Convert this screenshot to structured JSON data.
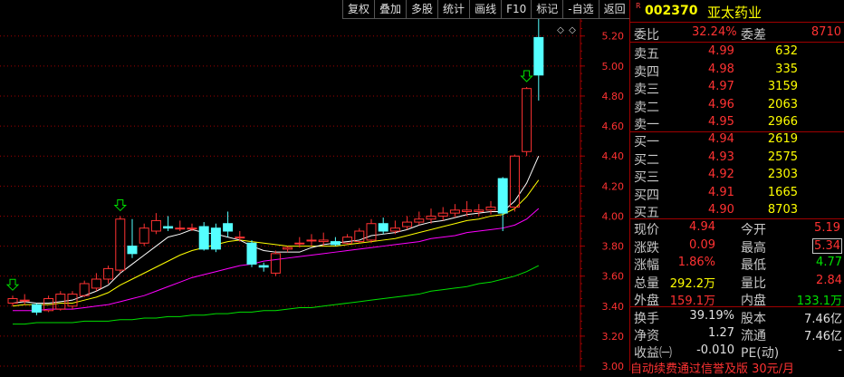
{
  "toolbar": {
    "items": [
      "复权",
      "叠加",
      "多股",
      "统计",
      "画线",
      "F10",
      "标记",
      "-自选",
      "返回"
    ]
  },
  "chart": {
    "y_axis_labels": [
      "5.20",
      "5.00",
      "4.80",
      "4.60",
      "4.40",
      "4.20",
      "4.00",
      "3.80",
      "3.60",
      "3.40",
      "3.20",
      "3.00"
    ],
    "max_marker": "5.34",
    "diamond": "◇"
  },
  "chart_data": {
    "type": "candlestick",
    "y_axis_ticks": [
      5.2,
      5.0,
      4.8,
      4.6,
      4.4,
      4.2,
      4.0,
      3.8,
      3.6,
      3.4,
      3.2,
      3.0
    ],
    "ylim": [
      2.97,
      5.44
    ],
    "candles": [
      {
        "o": 3.42,
        "c": 3.45,
        "h": 3.47,
        "l": 3.4
      },
      {
        "o": 3.44,
        "c": 3.44,
        "h": 3.48,
        "l": 3.41
      },
      {
        "o": 3.41,
        "c": 3.36,
        "h": 3.42,
        "l": 3.34
      },
      {
        "o": 3.37,
        "c": 3.45,
        "h": 3.47,
        "l": 3.36
      },
      {
        "o": 3.38,
        "c": 3.48,
        "h": 3.5,
        "l": 3.37
      },
      {
        "o": 3.4,
        "c": 3.48,
        "h": 3.5,
        "l": 3.38
      },
      {
        "o": 3.47,
        "c": 3.55,
        "h": 3.57,
        "l": 3.46
      },
      {
        "o": 3.52,
        "c": 3.58,
        "h": 3.62,
        "l": 3.5
      },
      {
        "o": 3.58,
        "c": 3.65,
        "h": 3.67,
        "l": 3.55
      },
      {
        "o": 3.64,
        "c": 3.98,
        "h": 4.0,
        "l": 3.62
      },
      {
        "o": 3.8,
        "c": 3.75,
        "h": 3.98,
        "l": 3.72
      },
      {
        "o": 3.82,
        "c": 3.92,
        "h": 3.95,
        "l": 3.8
      },
      {
        "o": 3.9,
        "c": 3.97,
        "h": 4.02,
        "l": 3.88
      },
      {
        "o": 3.93,
        "c": 3.92,
        "h": 4.0,
        "l": 3.9
      },
      {
        "o": 3.92,
        "c": 3.92,
        "h": 3.97,
        "l": 3.9
      },
      {
        "o": 3.92,
        "c": 3.92,
        "h": 3.95,
        "l": 3.9
      },
      {
        "o": 3.93,
        "c": 3.78,
        "h": 3.96,
        "l": 3.77
      },
      {
        "o": 3.92,
        "c": 3.78,
        "h": 3.95,
        "l": 3.76
      },
      {
        "o": 3.95,
        "c": 3.9,
        "h": 4.03,
        "l": 3.86
      },
      {
        "o": 3.86,
        "c": 3.86,
        "h": 3.9,
        "l": 3.83
      },
      {
        "o": 3.82,
        "c": 3.68,
        "h": 3.84,
        "l": 3.66
      },
      {
        "o": 3.67,
        "c": 3.66,
        "h": 3.69,
        "l": 3.63
      },
      {
        "o": 3.62,
        "c": 3.75,
        "h": 3.77,
        "l": 3.6
      },
      {
        "o": 3.78,
        "c": 3.79,
        "h": 3.8,
        "l": 3.76
      },
      {
        "o": 3.82,
        "c": 3.82,
        "h": 3.86,
        "l": 3.79
      },
      {
        "o": 3.84,
        "c": 3.84,
        "h": 3.88,
        "l": 3.8
      },
      {
        "o": 3.83,
        "c": 3.84,
        "h": 3.89,
        "l": 3.8
      },
      {
        "o": 3.83,
        "c": 3.81,
        "h": 3.86,
        "l": 3.8
      },
      {
        "o": 3.82,
        "c": 3.86,
        "h": 3.88,
        "l": 3.81
      },
      {
        "o": 3.83,
        "c": 3.9,
        "h": 3.92,
        "l": 3.82
      },
      {
        "o": 3.84,
        "c": 3.95,
        "h": 3.98,
        "l": 3.82
      },
      {
        "o": 3.95,
        "c": 3.9,
        "h": 3.99,
        "l": 3.88
      },
      {
        "o": 3.9,
        "c": 3.92,
        "h": 3.97,
        "l": 3.88
      },
      {
        "o": 3.93,
        "c": 3.96,
        "h": 4.0,
        "l": 3.91
      },
      {
        "o": 3.96,
        "c": 3.98,
        "h": 4.03,
        "l": 3.94
      },
      {
        "o": 3.98,
        "c": 4.0,
        "h": 4.05,
        "l": 3.95
      },
      {
        "o": 4.0,
        "c": 4.02,
        "h": 4.06,
        "l": 3.97
      },
      {
        "o": 4.02,
        "c": 4.04,
        "h": 4.08,
        "l": 3.99
      },
      {
        "o": 4.03,
        "c": 4.04,
        "h": 4.1,
        "l": 4.0
      },
      {
        "o": 4.03,
        "c": 4.04,
        "h": 4.08,
        "l": 4.0
      },
      {
        "o": 4.04,
        "c": 4.06,
        "h": 4.1,
        "l": 4.01
      },
      {
        "o": 4.25,
        "c": 4.02,
        "h": 4.26,
        "l": 3.9
      },
      {
        "o": 4.06,
        "c": 4.4,
        "h": 4.41,
        "l": 4.03
      },
      {
        "o": 4.43,
        "c": 4.85,
        "h": 4.86,
        "l": 4.4
      },
      {
        "o": 5.19,
        "c": 4.94,
        "h": 5.34,
        "l": 4.77
      }
    ],
    "ma_short": [
      3.42,
      3.43,
      3.42,
      3.42,
      3.43,
      3.44,
      3.47,
      3.5,
      3.54,
      3.62,
      3.68,
      3.74,
      3.8,
      3.86,
      3.88,
      3.91,
      3.89,
      3.88,
      3.86,
      3.84,
      3.8,
      3.77,
      3.76,
      3.76,
      3.76,
      3.79,
      3.81,
      3.82,
      3.83,
      3.84,
      3.87,
      3.88,
      3.89,
      3.91,
      3.94,
      3.96,
      3.97,
      3.99,
      4.01,
      4.02,
      4.03,
      4.03,
      4.1,
      4.22,
      4.4
    ],
    "ma_mid": [
      3.4,
      3.41,
      3.41,
      3.41,
      3.42,
      3.42,
      3.44,
      3.46,
      3.49,
      3.54,
      3.58,
      3.62,
      3.66,
      3.7,
      3.74,
      3.77,
      3.79,
      3.81,
      3.83,
      3.84,
      3.83,
      3.82,
      3.81,
      3.8,
      3.8,
      3.8,
      3.8,
      3.8,
      3.81,
      3.82,
      3.83,
      3.84,
      3.85,
      3.87,
      3.89,
      3.91,
      3.93,
      3.95,
      3.97,
      3.98,
      4.0,
      4.01,
      4.05,
      4.13,
      4.24
    ],
    "ma_long": [
      3.37,
      3.37,
      3.37,
      3.38,
      3.38,
      3.38,
      3.39,
      3.4,
      3.41,
      3.43,
      3.45,
      3.47,
      3.5,
      3.53,
      3.56,
      3.59,
      3.61,
      3.63,
      3.65,
      3.67,
      3.68,
      3.7,
      3.71,
      3.72,
      3.73,
      3.74,
      3.75,
      3.76,
      3.77,
      3.78,
      3.79,
      3.8,
      3.81,
      3.82,
      3.83,
      3.85,
      3.86,
      3.87,
      3.89,
      3.9,
      3.91,
      3.92,
      3.94,
      3.98,
      4.05
    ],
    "ma_xlong": [
      3.28,
      3.28,
      3.29,
      3.29,
      3.29,
      3.29,
      3.3,
      3.3,
      3.3,
      3.31,
      3.31,
      3.32,
      3.32,
      3.33,
      3.33,
      3.34,
      3.34,
      3.35,
      3.35,
      3.36,
      3.36,
      3.37,
      3.37,
      3.38,
      3.39,
      3.39,
      3.4,
      3.41,
      3.42,
      3.43,
      3.44,
      3.45,
      3.46,
      3.47,
      3.48,
      3.5,
      3.51,
      3.52,
      3.53,
      3.55,
      3.56,
      3.58,
      3.6,
      3.63,
      3.67
    ],
    "colors": {
      "up": "#ff3232",
      "down": "#54ffff",
      "ma_short": "#ffffff",
      "ma_mid": "#ffff00",
      "ma_long": "#ff00ff",
      "ma_xlong": "#00e000",
      "grid": "#a00000"
    },
    "markers": [
      0,
      9,
      43
    ]
  },
  "stock": {
    "r_mark": "R",
    "code": "002370",
    "name": "亚太药业"
  },
  "weibi": {
    "label1": "委比",
    "value1": "32.24%",
    "label2": "委差",
    "value2": "8710"
  },
  "sell": [
    {
      "label": "卖五",
      "price": "4.99",
      "vol": "632"
    },
    {
      "label": "卖四",
      "price": "4.98",
      "vol": "335"
    },
    {
      "label": "卖三",
      "price": "4.97",
      "vol": "3159"
    },
    {
      "label": "卖二",
      "price": "4.96",
      "vol": "2063"
    },
    {
      "label": "卖一",
      "price": "4.95",
      "vol": "2966"
    }
  ],
  "buy": [
    {
      "label": "买一",
      "price": "4.94",
      "vol": "2619"
    },
    {
      "label": "买二",
      "price": "4.93",
      "vol": "2575"
    },
    {
      "label": "买三",
      "price": "4.92",
      "vol": "2303"
    },
    {
      "label": "买四",
      "price": "4.91",
      "vol": "1665"
    },
    {
      "label": "买五",
      "price": "4.90",
      "vol": "8703"
    }
  ],
  "quote": [
    {
      "l1": "现价",
      "v1": "4.94",
      "l2": "今开",
      "v2": "5.19"
    },
    {
      "l1": "涨跌",
      "v1": "0.09",
      "l2": "最高",
      "v2": "5.34"
    },
    {
      "l1": "涨幅",
      "v1": "1.86%",
      "l2": "最低",
      "v2": "4.77"
    },
    {
      "l1": "总量",
      "v1": "292.2万",
      "l2": "量比",
      "v2": "2.84"
    },
    {
      "l1": "外盘",
      "v1": "159.1万",
      "l2": "内盘",
      "v2": "133.1万"
    }
  ],
  "stats": [
    {
      "l1": "换手",
      "v1": "39.19%",
      "l2": "股本",
      "v2": "7.46亿"
    },
    {
      "l1": "净资",
      "v1": "1.27",
      "l2": "流通",
      "v2": "7.46亿"
    },
    {
      "l1": "收益㈠",
      "v1": "-0.010",
      "l2": "PE(动)",
      "v2": "-"
    }
  ],
  "footer": "自动续费通过信誉及版   30元/月"
}
